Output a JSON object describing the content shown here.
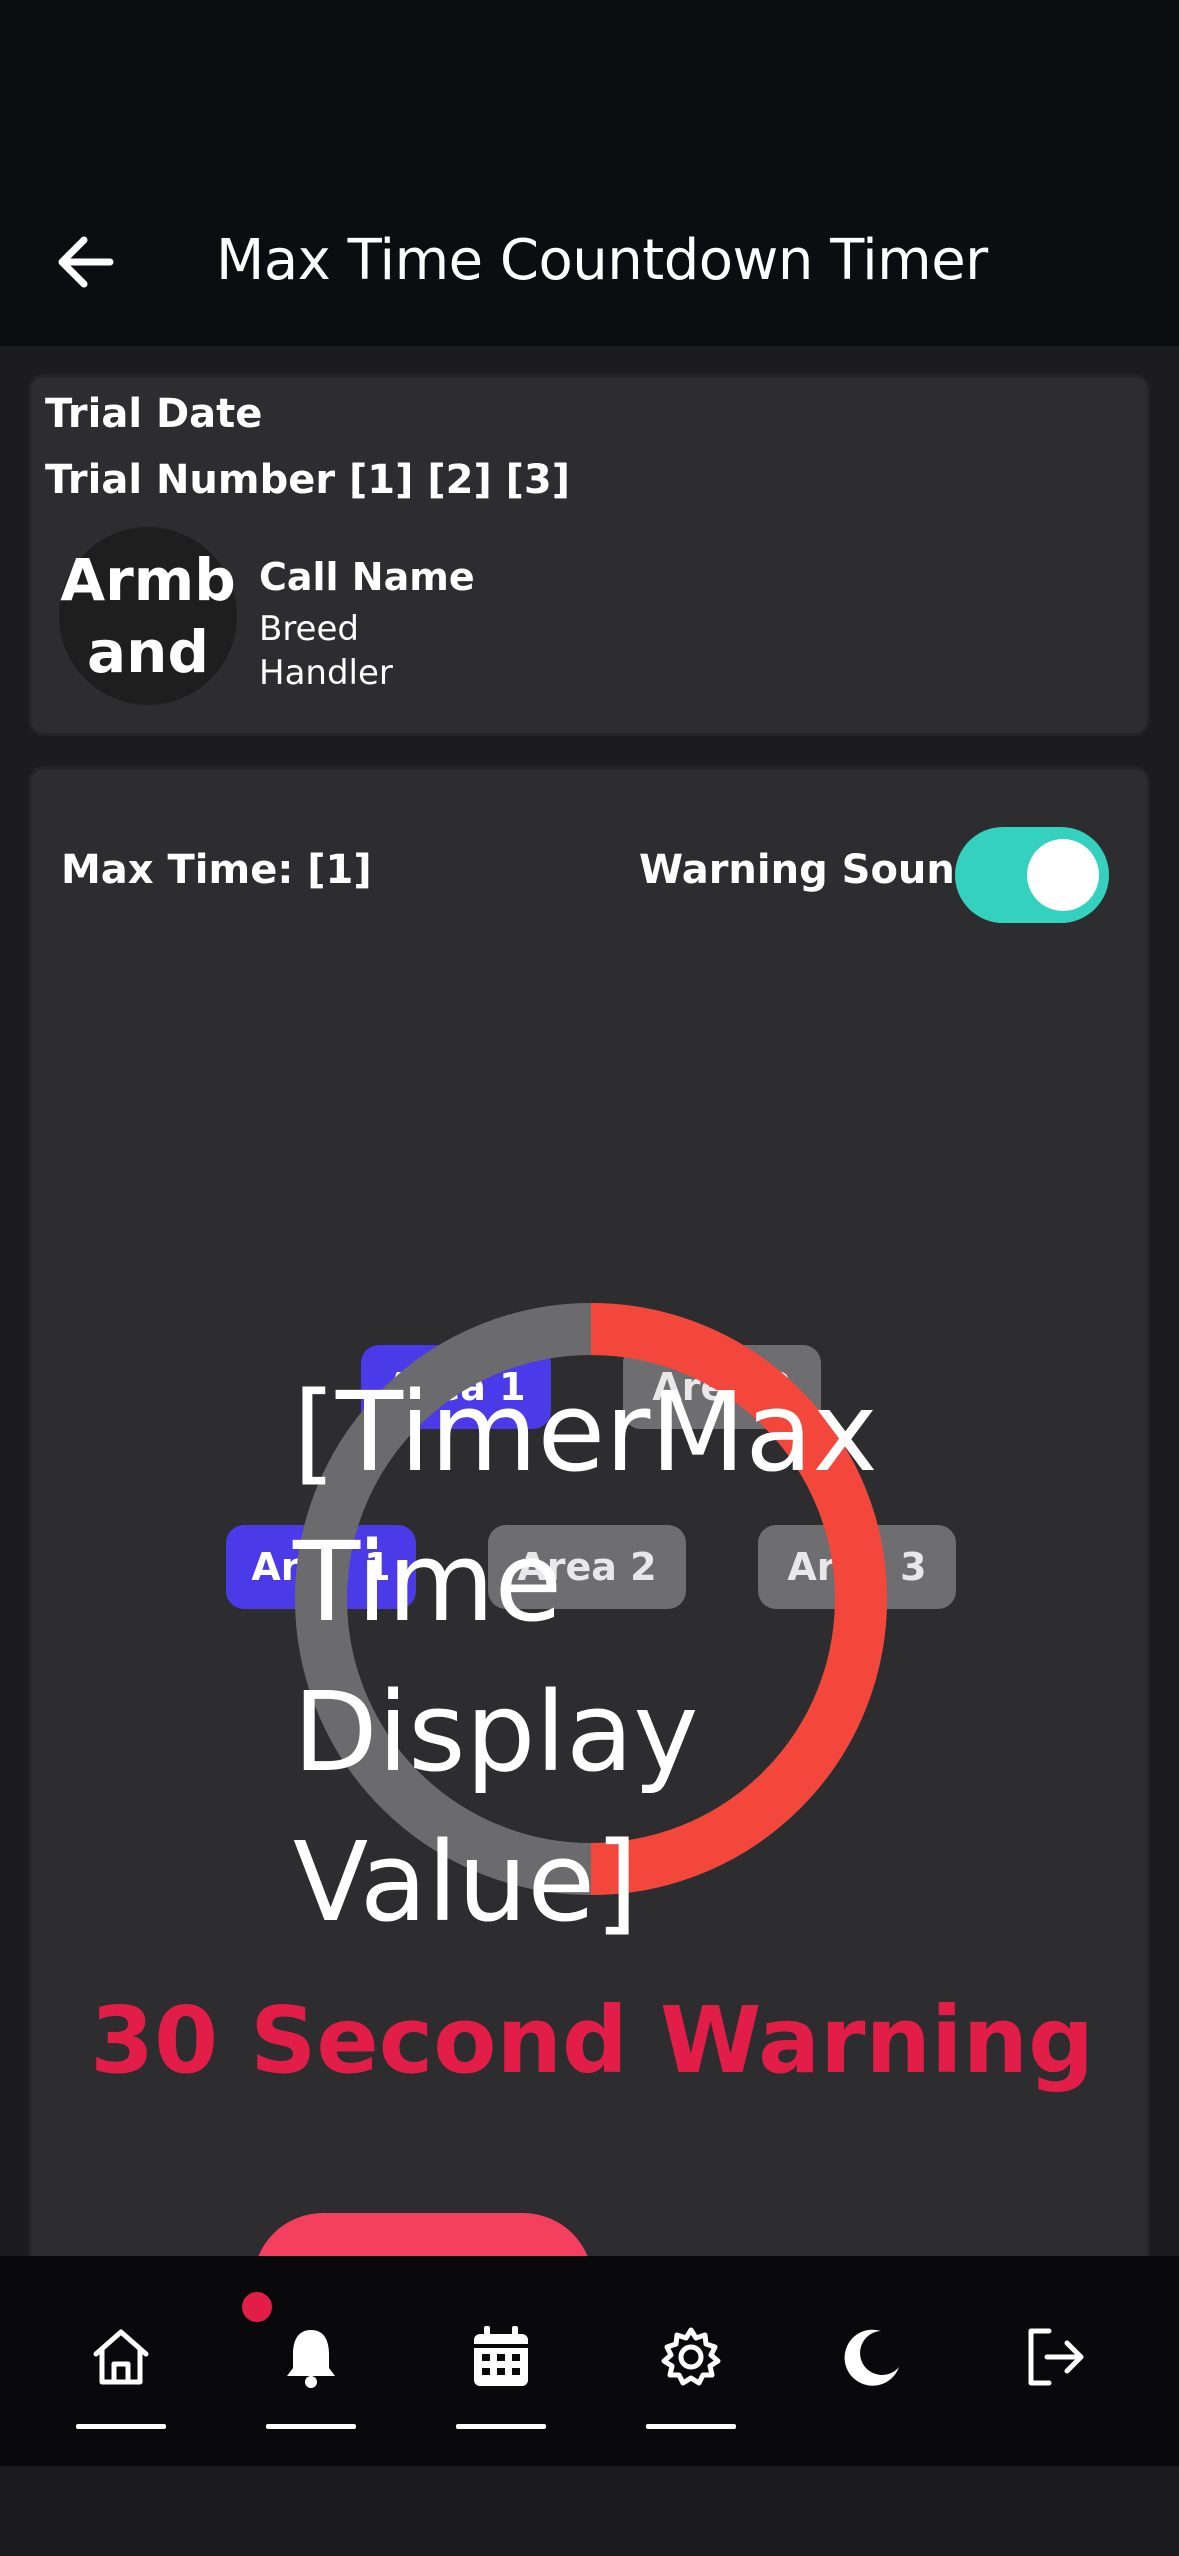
{
  "header": {
    "title": "Max Time Countdown Timer",
    "back_icon": "arrow-left-icon"
  },
  "info_card": {
    "trial_date": "Trial Date",
    "trial_number": "Trial Number  [1] [2] [3]",
    "avatar_text": "Armband",
    "call_name": "Call Name",
    "breed": "Breed",
    "handler": "Handler"
  },
  "timer": {
    "max_time_label": "Max Time: [1]",
    "warning_sound_label": "Warning Sound",
    "warning_sound_on": true,
    "search_areas": [
      {
        "label": "Area 1",
        "active": true
      },
      {
        "label": "Area 2",
        "active": false
      }
    ],
    "hide_areas": [
      {
        "label": "Area 1",
        "active": true
      },
      {
        "label": "Area 2",
        "active": false
      },
      {
        "label": "Area 3",
        "active": false
      }
    ],
    "display_value": "[TimerMax Time Display Value]",
    "progress_fraction": 0.5,
    "warning_text": "30 Second Warning",
    "colors": {
      "progress": "#f4473b",
      "track": "#6b6b6d",
      "warning": "#e11d48",
      "accent": "#4a3ae8",
      "toggle": "#34d1bf"
    }
  },
  "nav": {
    "items": [
      {
        "icon": "home-icon",
        "underline": true
      },
      {
        "icon": "bell-icon",
        "underline": true,
        "badge": true
      },
      {
        "icon": "calendar-icon",
        "underline": true
      },
      {
        "icon": "gear-icon",
        "underline": true
      },
      {
        "icon": "moon-icon",
        "underline": false
      },
      {
        "icon": "logout-icon",
        "underline": false
      }
    ]
  }
}
